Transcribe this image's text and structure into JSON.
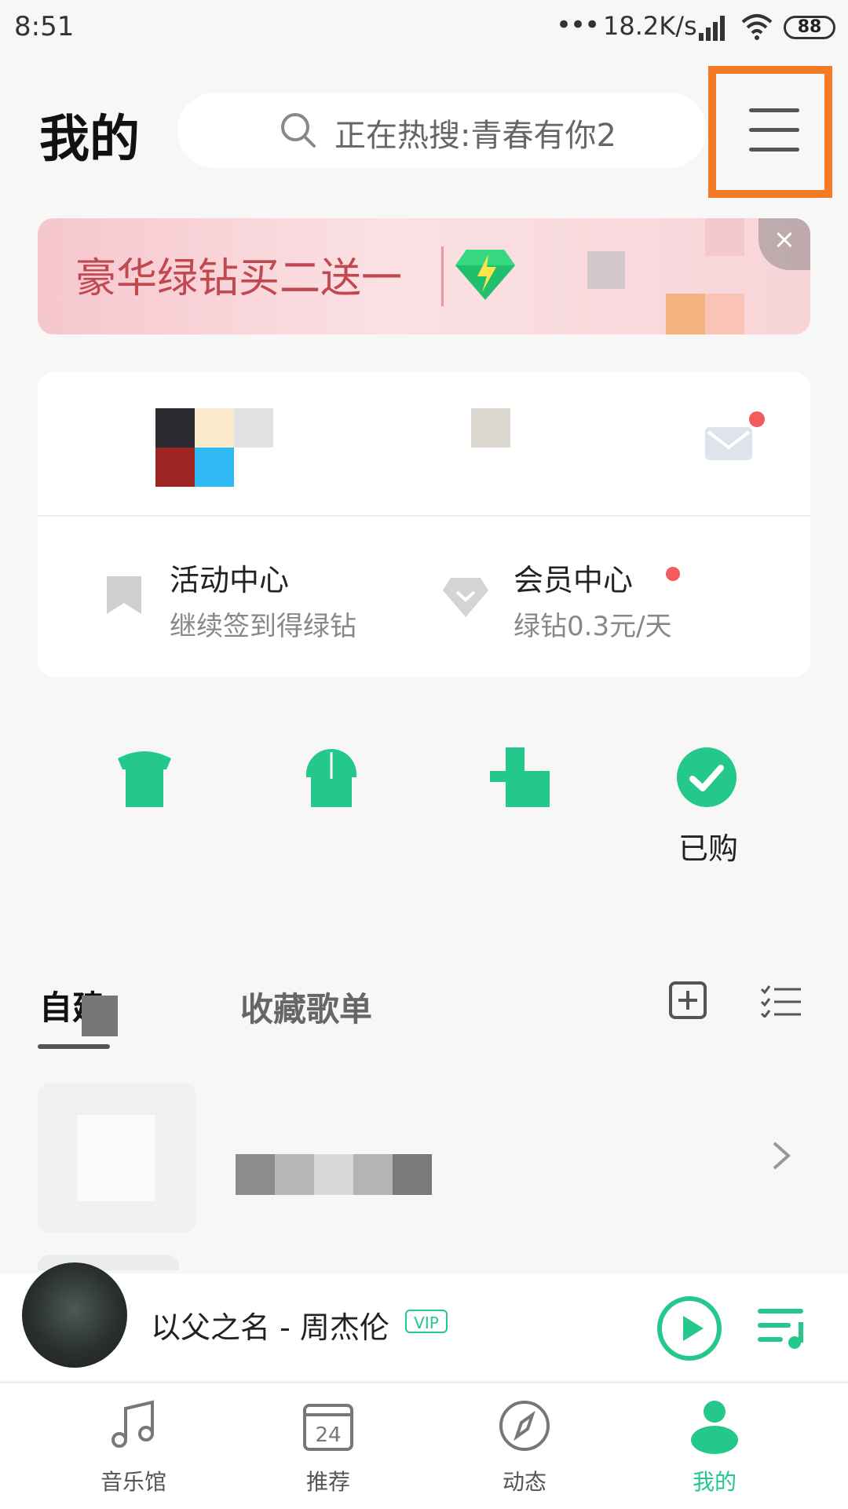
{
  "status_bar": {
    "time": "8:51",
    "dots": "•••",
    "speed": "18.2K/s",
    "battery": "88"
  },
  "header": {
    "title": "我的",
    "search_placeholder": "正在热搜:青春有你2"
  },
  "banner": {
    "text": "豪华绿钻买二送一",
    "close": "×"
  },
  "profile": {
    "activity": {
      "title": "活动中心",
      "subtitle": "继续签到得绿钻"
    },
    "vip": {
      "title": "会员中心",
      "subtitle": "绿钻0.3元/天"
    }
  },
  "quick_actions": {
    "purchased_label": "已购"
  },
  "tabs": {
    "self_built": "自建",
    "collected": "收藏歌单"
  },
  "player": {
    "song": "以父之名 - 周杰伦",
    "vip_tag": "VIP"
  },
  "nav": {
    "items": [
      {
        "label": "音乐馆",
        "icon": "music-note-icon"
      },
      {
        "label": "推荐",
        "icon": "calendar-24-icon"
      },
      {
        "label": "动态",
        "icon": "compass-icon"
      },
      {
        "label": "我的",
        "icon": "profile-icon"
      }
    ],
    "calendar_day": "24"
  },
  "colors": {
    "accent": "#23c88a",
    "highlight": "#f47a25",
    "badge": "#f25c5c"
  }
}
